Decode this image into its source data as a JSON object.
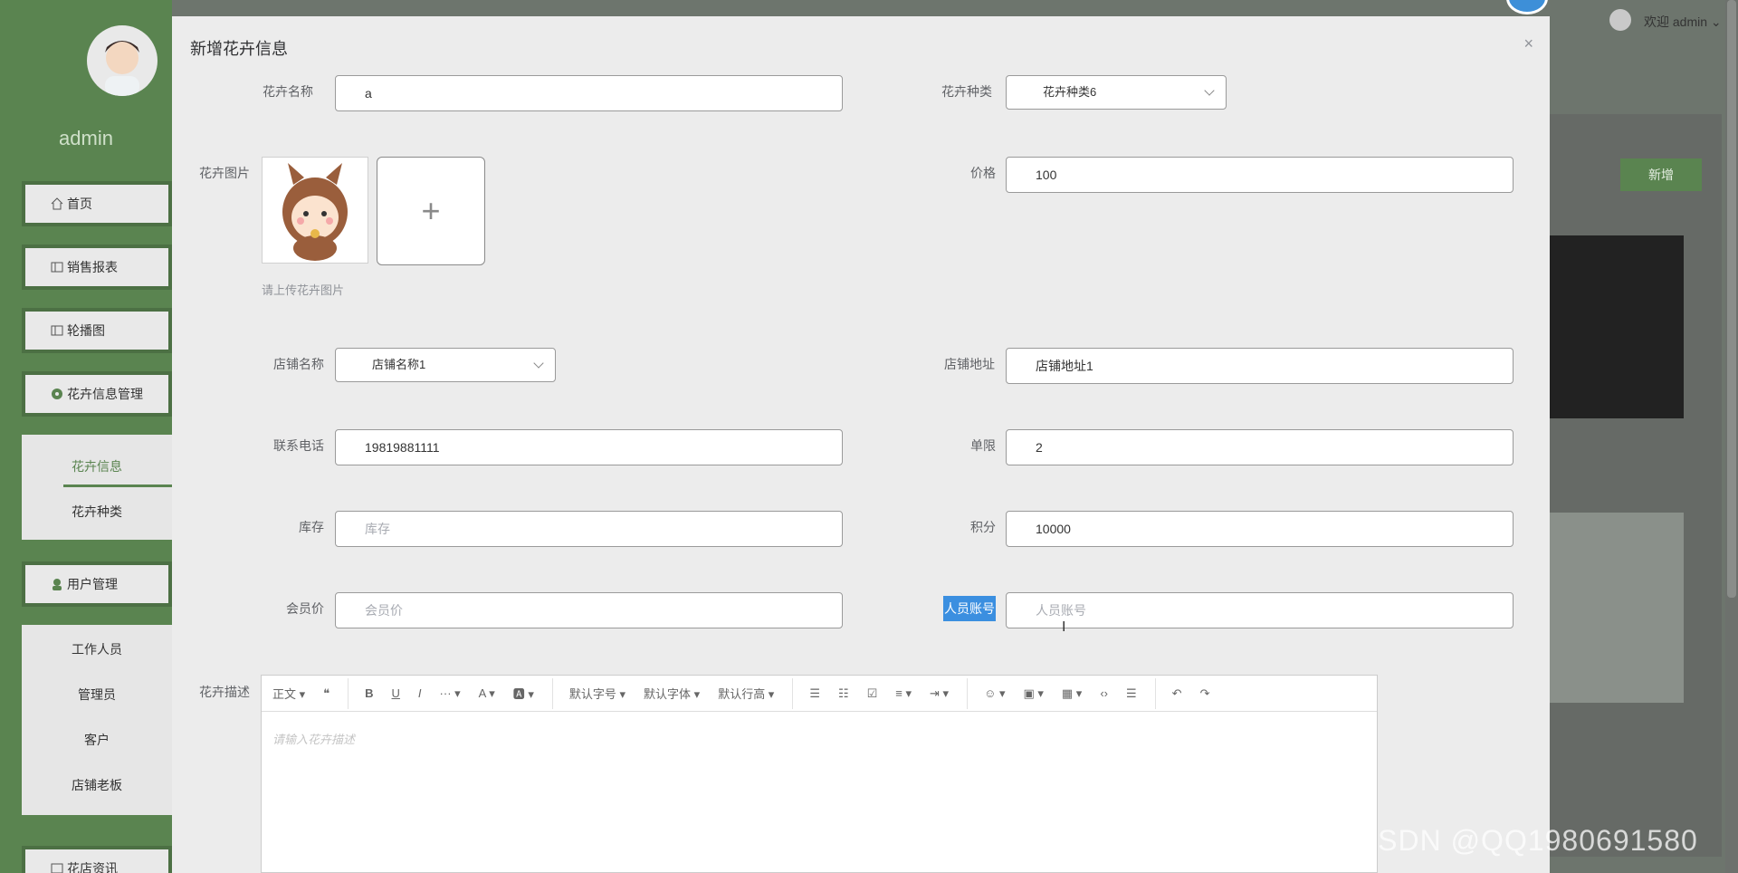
{
  "sidebar": {
    "username": "admin",
    "menu": [
      {
        "label": "首页",
        "icon": "home-icon"
      },
      {
        "label": "销售报表",
        "icon": "book-icon"
      },
      {
        "label": "轮播图",
        "icon": "book-icon"
      },
      {
        "label": "花卉信息管理",
        "icon": "flower-icon"
      }
    ],
    "flower_sub": [
      "花卉信息",
      "花卉种类"
    ],
    "user_menu": {
      "label": "用户管理",
      "icon": "user-icon"
    },
    "user_sub": [
      "工作人员",
      "管理员",
      "客户",
      "店铺老板"
    ],
    "news_menu": {
      "label": "花店资讯",
      "icon": "book-icon"
    }
  },
  "topbar": {
    "welcome": "欢迎 admin"
  },
  "background": {
    "add_button": "新增"
  },
  "dialog": {
    "title": "新增花卉信息",
    "close": "×",
    "fields": {
      "name": {
        "label": "花卉名称",
        "value": "a"
      },
      "category": {
        "label": "花卉种类",
        "value": "花卉种类6"
      },
      "image": {
        "label": "花卉图片",
        "tip": "请上传花卉图片",
        "plus": "+"
      },
      "price": {
        "label": "价格",
        "value": "100"
      },
      "shop_name": {
        "label": "店铺名称",
        "value": "店铺名称1"
      },
      "shop_address": {
        "label": "店铺地址",
        "value": "店铺地址1"
      },
      "phone": {
        "label": "联系电话",
        "value": "19819881111"
      },
      "limit": {
        "label": "单限",
        "value": "2"
      },
      "stock": {
        "label": "库存",
        "placeholder": "库存"
      },
      "points": {
        "label": "积分",
        "value": "10000"
      },
      "member_price": {
        "label": "会员价",
        "placeholder": "会员价"
      },
      "staff_account": {
        "label": "人员账号",
        "placeholder": "人员账号"
      },
      "description": {
        "label": "花卉描述",
        "placeholder": "请输入花卉描述"
      }
    },
    "editor_toolbar": [
      "正文 ▾",
      "❝",
      "B",
      "U",
      "I",
      "··· ▾",
      "A ▾",
      "🅰 ▾",
      "默认字号 ▾",
      "默认字体 ▾",
      "默认行高 ▾",
      "☰",
      "☷",
      "☑",
      "≡ ▾",
      "⇥ ▾",
      "☺ ▾",
      "▣ ▾",
      "▦ ▾",
      "‹›",
      "☰",
      "↶",
      "↷"
    ]
  },
  "watermark": "CSDN @QQ1980691580",
  "colors": {
    "accent": "#5a8450",
    "highlight": "#3b8fe0"
  }
}
